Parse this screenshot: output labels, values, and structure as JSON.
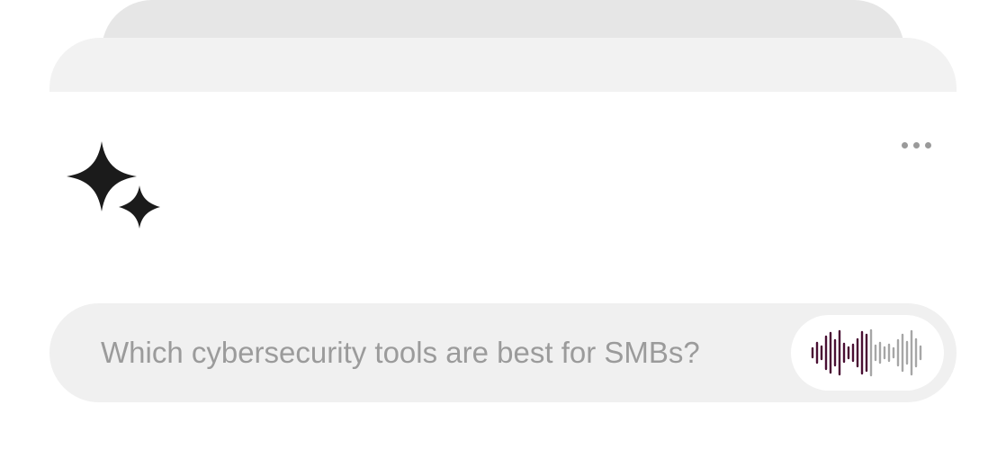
{
  "prompt": {
    "text": "Which cybersecurity tools are best for SMBs?"
  },
  "icons": {
    "assistant": "sparkle-icon",
    "menu": "more-horizontal-icon",
    "voice": "audio-waveform-icon"
  },
  "colors": {
    "sparkle": "#1b1b1b",
    "waveform_active": "#4a0f33",
    "waveform_inactive": "#a6a6a6",
    "prompt_text": "#9b9b9b",
    "prompt_bg": "#f0f0f0"
  },
  "waveform": {
    "active_fraction": 0.5
  }
}
